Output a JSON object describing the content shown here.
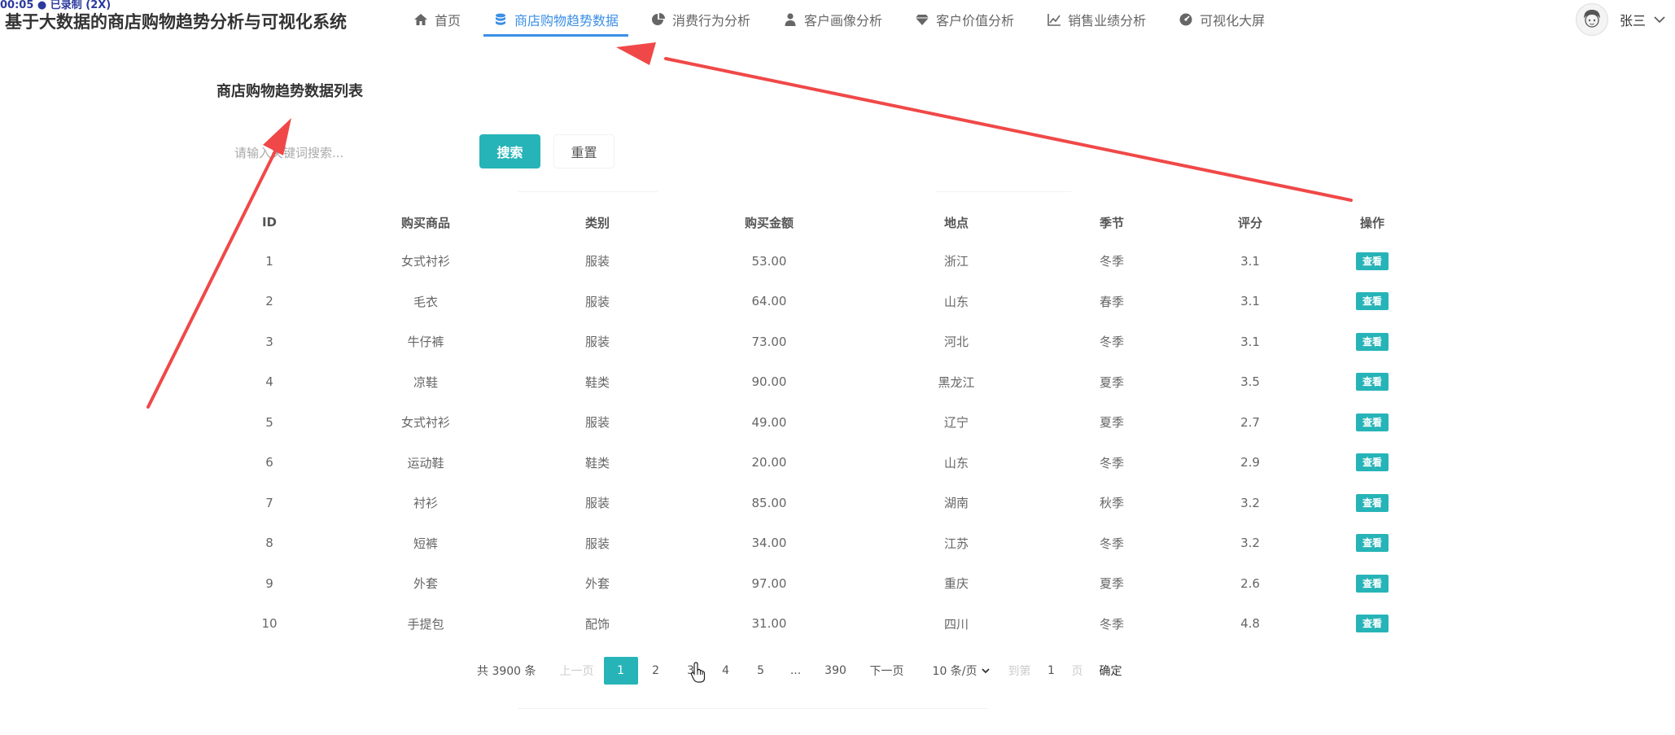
{
  "recording_badge": "00:05 ● 已录制 (2X)",
  "app_title": "基于大数据的商店购物趋势分析与可视化系统",
  "nav": {
    "items": [
      {
        "label": "首页",
        "icon": "home-icon"
      },
      {
        "label": "商店购物趋势数据",
        "icon": "database-icon",
        "active": true
      },
      {
        "label": "消费行为分析",
        "icon": "pie-chart-icon"
      },
      {
        "label": "客户画像分析",
        "icon": "user-icon"
      },
      {
        "label": "客户价值分析",
        "icon": "diamond-icon"
      },
      {
        "label": "销售业绩分析",
        "icon": "line-chart-icon"
      },
      {
        "label": "可视化大屏",
        "icon": "dashboard-icon"
      }
    ],
    "active_color": "#3b8fe6"
  },
  "user": {
    "name": "张三",
    "avatar_icon": "avatar-icon",
    "caret_icon": "chevron-down-icon"
  },
  "page_title": "商店购物趋势数据列表",
  "search": {
    "placeholder": "请输入关键词搜索...",
    "search_label": "搜索",
    "reset_label": "重置"
  },
  "table": {
    "headers": [
      "ID",
      "购买商品",
      "类别",
      "购买金额",
      "地点",
      "季节",
      "评分",
      "操作"
    ],
    "view_label": "查看",
    "rows": [
      [
        "1",
        "女式衬衫",
        "服装",
        "53.00",
        "浙江",
        "冬季",
        "3.1"
      ],
      [
        "2",
        "毛衣",
        "服装",
        "64.00",
        "山东",
        "春季",
        "3.1"
      ],
      [
        "3",
        "牛仔裤",
        "服装",
        "73.00",
        "河北",
        "冬季",
        "3.1"
      ],
      [
        "4",
        "凉鞋",
        "鞋类",
        "90.00",
        "黑龙江",
        "夏季",
        "3.5"
      ],
      [
        "5",
        "女式衬衫",
        "服装",
        "49.00",
        "辽宁",
        "夏季",
        "2.7"
      ],
      [
        "6",
        "运动鞋",
        "鞋类",
        "20.00",
        "山东",
        "冬季",
        "2.9"
      ],
      [
        "7",
        "衬衫",
        "服装",
        "85.00",
        "湖南",
        "秋季",
        "3.2"
      ],
      [
        "8",
        "短裤",
        "服装",
        "34.00",
        "江苏",
        "冬季",
        "3.2"
      ],
      [
        "9",
        "外套",
        "外套",
        "97.00",
        "重庆",
        "夏季",
        "2.6"
      ],
      [
        "10",
        "手提包",
        "配饰",
        "31.00",
        "四川",
        "冬季",
        "4.8"
      ]
    ]
  },
  "pagination": {
    "total": "共 3900 条",
    "prev": "上一页",
    "pages": [
      "1",
      "2",
      "3",
      "4",
      "5",
      "...",
      "390"
    ],
    "current": "1",
    "next": "下一页",
    "page_size": "10 条/页",
    "jump_prefix": "到第",
    "jump_value": "1",
    "jump_suffix": "页",
    "confirm": "确定"
  },
  "colors": {
    "accent": "#26b4b8",
    "annotation_arrow": "#f04848"
  }
}
